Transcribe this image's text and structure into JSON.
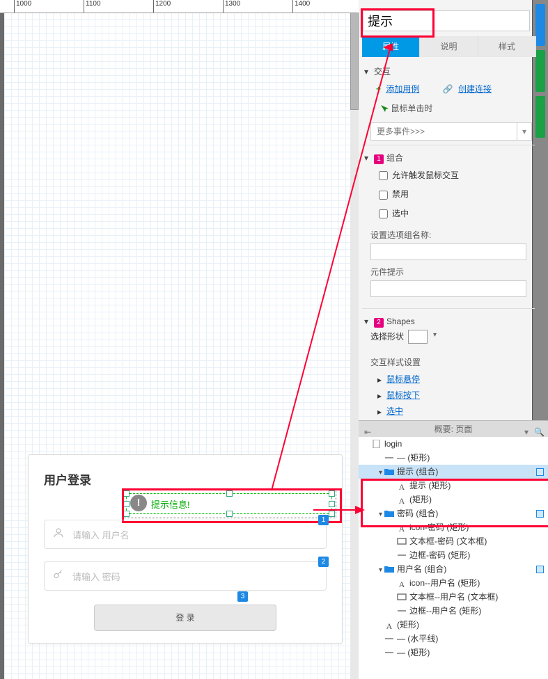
{
  "ruler": {
    "ticks": [
      "",
      "1000",
      "",
      "1100",
      "",
      "1200",
      "",
      "1300",
      "",
      "1400",
      ""
    ]
  },
  "canvas": {
    "login_title": "用户登录",
    "tip_text": "提示信息!",
    "username_placeholder": "请输入 用户名",
    "password_placeholder": "请输入 密码",
    "login_button": "登 录",
    "badges": {
      "one": "1",
      "two": "2",
      "three": "3"
    }
  },
  "inspector": {
    "name_value": "提示",
    "tabs": {
      "props": "属性",
      "notes": "说明",
      "style": "样式"
    },
    "interaction_section": "交互",
    "add_case": "添加用例",
    "create_link": "创建连接",
    "mouse_click": "鼠标单击时",
    "more_events": "更多事件>>>",
    "group_section": "组合",
    "group_num": "1",
    "chk_allow": "允许触发鼠标交互",
    "chk_disable": "禁用",
    "chk_selected": "选中",
    "set_option_group": "设置选项组名称:",
    "widget_tooltip": "元件提示",
    "shapes_section": "Shapes",
    "shapes_num": "2",
    "pick_shape": "选择形状",
    "ix_style": "交互样式设置",
    "hover": "鼠标悬停",
    "mousedown": "鼠标按下",
    "selected": "选中"
  },
  "outline": {
    "header": "概要: 页面",
    "rows": [
      {
        "indent": 0,
        "tw": "",
        "icon": "page",
        "label": "login"
      },
      {
        "indent": 1,
        "tw": "",
        "icon": "line",
        "label": "— (矩形)"
      },
      {
        "indent": 1,
        "tw": "▿",
        "icon": "folder",
        "label": "提示 (组合)",
        "sel": true,
        "color": true
      },
      {
        "indent": 2,
        "tw": "",
        "icon": "A",
        "label": "提示 (矩形)"
      },
      {
        "indent": 2,
        "tw": "",
        "icon": "A",
        "label": "(矩形)"
      },
      {
        "indent": 1,
        "tw": "▿",
        "icon": "folder",
        "label": "密码 (组合)",
        "color": true
      },
      {
        "indent": 2,
        "tw": "",
        "icon": "A",
        "label": "icon-密码 (矩形)"
      },
      {
        "indent": 2,
        "tw": "",
        "icon": "rect",
        "label": "文本框-密码 (文本框)"
      },
      {
        "indent": 2,
        "tw": "",
        "icon": "line",
        "label": "边框-密码 (矩形)"
      },
      {
        "indent": 1,
        "tw": "▿",
        "icon": "folder",
        "label": "用户名 (组合)",
        "color": true
      },
      {
        "indent": 2,
        "tw": "",
        "icon": "A",
        "label": "icon--用户名 (矩形)"
      },
      {
        "indent": 2,
        "tw": "",
        "icon": "rect",
        "label": "文本框--用户名 (文本框)"
      },
      {
        "indent": 2,
        "tw": "",
        "icon": "line",
        "label": "边框--用户名 (矩形)"
      },
      {
        "indent": 1,
        "tw": "",
        "icon": "A",
        "label": "(矩形)"
      },
      {
        "indent": 1,
        "tw": "",
        "icon": "line",
        "label": "— (水平线)"
      },
      {
        "indent": 1,
        "tw": "",
        "icon": "line",
        "label": "— (矩形)"
      }
    ]
  }
}
